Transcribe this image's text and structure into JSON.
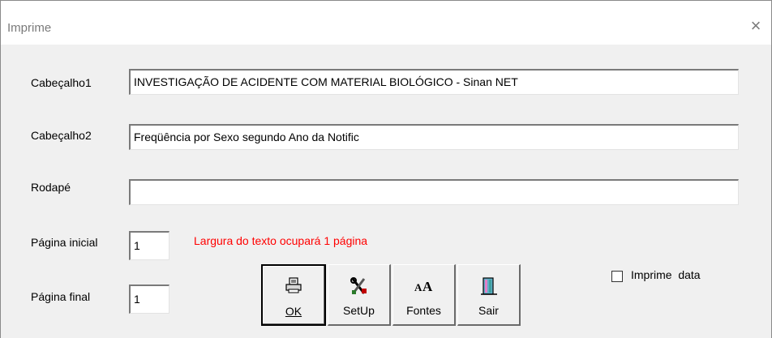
{
  "window": {
    "title": "Imprime",
    "close_glyph": "×"
  },
  "form": {
    "cabecalho1_label": "Cabeçalho1",
    "cabecalho1_value": "INVESTIGAÇÃO DE ACIDENTE COM MATERIAL BIOLÓGICO - Sinan NET",
    "cabecalho2_label": "Cabeçalho2",
    "cabecalho2_value": "Freqüência por Sexo segundo Ano da Notific",
    "rodape_label": "Rodapé",
    "rodape_value": "",
    "pagina_inicial_label": "Página inicial",
    "pagina_inicial_value": "1",
    "pagina_final_label": "Página final",
    "pagina_final_value": "1",
    "width_notice": "Largura do texto ocupará 1 página",
    "imprime_data_label": "Imprime  data",
    "imprime_data_checked": false
  },
  "buttons": {
    "ok": {
      "label": "OK",
      "icon": "printer-icon"
    },
    "setup": {
      "label": "SetUp",
      "icon": "setup-tools-icon"
    },
    "fontes": {
      "label": "Fontes",
      "icon": "font-icon"
    },
    "sair": {
      "label": "Sair",
      "icon": "exit-door-icon"
    }
  },
  "colors": {
    "warning": "#ff0000",
    "dialog_bg": "#f0f0f0",
    "titlebar_bg": "#ffffff"
  }
}
